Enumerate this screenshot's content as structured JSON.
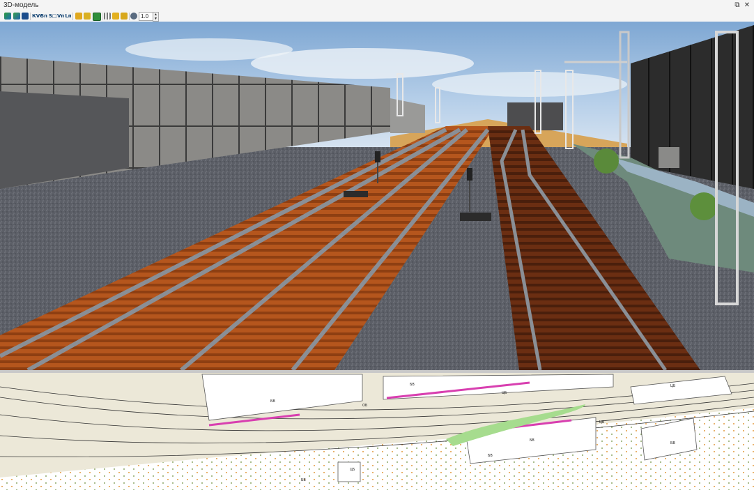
{
  "window": {
    "title": "3D-модель",
    "restore_glyph": "⧉",
    "close_glyph": "✕"
  },
  "toolbar": {
    "buttons": [
      {
        "name": "rotate-view-button",
        "label": "",
        "icon": "rotate-view-icon"
      },
      {
        "name": "scene-layers-button",
        "label": "",
        "icon": "layers-icon"
      },
      {
        "name": "grid-button",
        "label": "",
        "icon": "grid-icon"
      },
      {
        "name": "kvs-button",
        "label": "КVС"
      },
      {
        "name": "s-button",
        "label": "Sп"
      },
      {
        "name": "s-area-button",
        "label": "S□"
      },
      {
        "name": "v-button",
        "label": "Vп"
      },
      {
        "name": "l-button",
        "label": "Lп"
      },
      {
        "name": "camera-button",
        "label": "",
        "icon": "camera-icon"
      },
      {
        "name": "view-button",
        "label": "",
        "icon": "eye-icon"
      },
      {
        "name": "map-button",
        "label": "",
        "icon": "map-icon"
      },
      {
        "name": "route-button",
        "label": "",
        "icon": "route-icon"
      },
      {
        "name": "track-button",
        "label": "",
        "icon": "track-icon"
      },
      {
        "name": "layer-button",
        "label": "",
        "icon": "layer-icon"
      },
      {
        "name": "settings-button",
        "label": "",
        "icon": "gear-icon"
      }
    ],
    "zoom_value": "1.0",
    "spin_up": "▲",
    "spin_down": "▼"
  },
  "map": {
    "labels": [
      "БВ",
      "ОБ",
      "БВ",
      "ЦБ",
      "БВ",
      "БВ",
      "ЦБ",
      "ЦБ",
      "БВ",
      "БВ",
      "ЦБ"
    ]
  },
  "colors": {
    "sky": "#8fb3d9",
    "ballast": "#5b5e66",
    "sleepers": "#b0541c",
    "rails": "#8a8f96",
    "wall": "#8d8d8b",
    "map_corridor": "#ece8d8",
    "map_building_accent": "#d83fb0",
    "map_vegetation": "#a6dc8e"
  }
}
